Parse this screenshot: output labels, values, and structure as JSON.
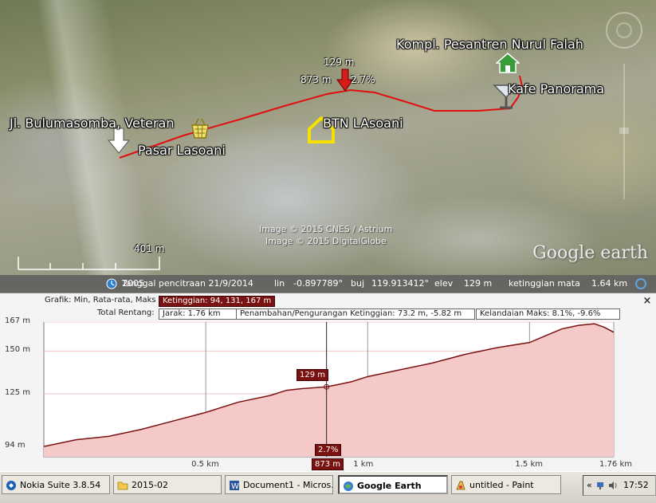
{
  "map": {
    "labels": {
      "kompl": "Kompl. Pesantren Nurul Falah",
      "kafe": "Kafe Panorama",
      "btn": "BTN LAsoani",
      "jl": "Jl. Bulumasomba, Veteran",
      "pasar": "Pasar Lasoani"
    },
    "cursor_readout": {
      "elevation": "129 m",
      "distance": "873 m",
      "slope": "2.7%"
    },
    "scale_label": "401 m",
    "copyright_1": "Image © 2015 CNES / Astrium",
    "copyright_2": "Image © 2015 DigitalGlobe",
    "logo": "Google earth"
  },
  "status_bar": {
    "year": "2005",
    "imagery_date": "Tanggal pencitraan 21/9/2014",
    "lat_label": "lin",
    "lat_value": "-0.897789°",
    "lon_label": "buj",
    "lon_value": "119.913412°",
    "elev_label": "elev",
    "elev_value": "129 m",
    "eye_label": "ketinggian mata",
    "eye_value": "1.64 km"
  },
  "profile": {
    "graph_label": "Grafik: Min, Rata-rata, Maks",
    "graph_value": "Ketinggian: 94, 131, 167 m",
    "range_label": "Total Rentang:",
    "distance": "Jarak: 1.76 km",
    "gain_loss": "Penambahan/Pengurangan Ketinggian: 73.2 m, -5.82 m",
    "max_slope": "Kelandaian Maks: 8.1%, -9.6%",
    "close_symbol": "×",
    "cursor_elev_tag": "129 m",
    "cursor_slope_tag": "2.7%",
    "cursor_dist_tag": "873 m"
  },
  "chart_data": {
    "type": "area",
    "x_unit": "km",
    "y_unit": "m",
    "xlim": [
      0,
      1.76
    ],
    "ylim": [
      88,
      167
    ],
    "y_ticks": [
      {
        "value": 94,
        "label": "94 m"
      },
      {
        "value": 125,
        "label": "125 m"
      },
      {
        "value": 150,
        "label": "150 m"
      },
      {
        "value": 167,
        "label": "167 m"
      }
    ],
    "x_ticks": [
      {
        "value": 0.5,
        "label": "0.5 km"
      },
      {
        "value": 1.0,
        "label": "1 km"
      },
      {
        "value": 1.5,
        "label": "1.5 km"
      },
      {
        "value": 1.76,
        "label": "1.76 km"
      }
    ],
    "series": [
      {
        "x": [
          0,
          0.05,
          0.1,
          0.2,
          0.3,
          0.4,
          0.5,
          0.55,
          0.6,
          0.7,
          0.75,
          0.8,
          0.873,
          0.9,
          0.95,
          1.0,
          1.1,
          1.2,
          1.3,
          1.4,
          1.5,
          1.55,
          1.6,
          1.65,
          1.7,
          1.73,
          1.76
        ],
        "y": [
          94,
          96,
          98,
          100,
          104,
          109,
          114,
          117,
          120,
          124,
          127,
          128,
          129,
          130,
          132,
          135,
          139,
          143,
          148,
          152,
          155,
          159,
          163,
          165,
          166,
          164,
          161
        ]
      }
    ],
    "cursor": {
      "x": 0.873,
      "y": 129,
      "slope": "2.7%"
    },
    "grid": true,
    "line_color": "#7a1212",
    "fill_color": "#f6c9c9"
  },
  "taskbar": {
    "items": [
      {
        "label": "Nokia Suite 3.8.54",
        "icon": "nokia-icon"
      },
      {
        "label": "2015-02",
        "icon": "folder-icon"
      },
      {
        "label": "Document1 - Micros...",
        "icon": "word-icon"
      },
      {
        "label": "Google Earth",
        "icon": "google-earth-icon"
      },
      {
        "label": "untitled - Paint",
        "icon": "paint-icon"
      }
    ],
    "clock": "17:52",
    "tray_arrows": "«"
  },
  "colors": {
    "route": "#e01010",
    "marker_red": "#d81b1b",
    "accent_dark": "#7a1212"
  }
}
